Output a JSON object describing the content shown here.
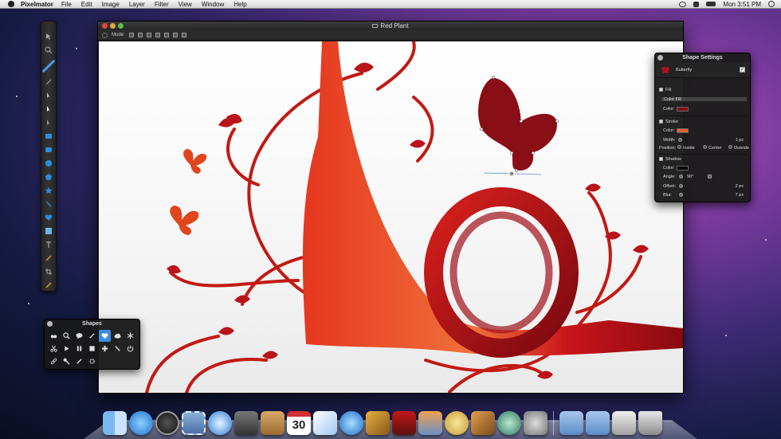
{
  "menubar": {
    "app_name": "Pixelmator",
    "items": [
      "File",
      "Edit",
      "Image",
      "Layer",
      "Filter",
      "View",
      "Window",
      "Help"
    ],
    "clock": "Mon 3:51 PM",
    "icons": [
      "apple-icon",
      "wifi-icon",
      "volume-icon",
      "battery-icon",
      "spotlight-icon"
    ]
  },
  "tools": {
    "icons": [
      "move-icon",
      "zoom-icon",
      "brush-icon",
      "pen-icon",
      "selection-arrow-icon",
      "arrow-icon",
      "pointer-icon",
      "rectangle-icon",
      "rounded-rectangle-icon",
      "ellipse-icon",
      "polygon-icon",
      "star-icon",
      "line-icon",
      "heart-icon",
      "gradient-icon",
      "text-icon",
      "paint-bucket-icon",
      "crop-icon",
      "eyedropper-icon"
    ]
  },
  "document": {
    "title": "Red Plant",
    "mode_label": "Mode:"
  },
  "shapes_palette": {
    "title": "Shapes",
    "selected_index": 4,
    "items": [
      "binoculars-icon",
      "magnifier-icon",
      "speech-bubble-icon",
      "pin-icon",
      "heart-icon",
      "cloud-icon",
      "snowflake-icon",
      "scissors-icon",
      "play-icon",
      "pause-icon",
      "stop-icon",
      "plus-icon",
      "pencil-icon",
      "power-icon",
      "link-icon",
      "brush-icon",
      "check-icon",
      "gear-icon"
    ]
  },
  "shape_settings": {
    "title": "Shape Settings",
    "shape_name": "Butterfly",
    "fill": {
      "label": "Fill",
      "type": "Color Fill",
      "color_label": "Color:",
      "color": "#8a0e16"
    },
    "stroke": {
      "label": "Stroke",
      "color_label": "Color:",
      "color": "#e2622e",
      "width_label": "Width:",
      "width_value": "1 px",
      "position_label": "Position:",
      "positions": [
        "Inside",
        "Center",
        "Outside"
      ]
    },
    "shadow": {
      "label": "Shadow",
      "color_label": "Color:",
      "color": "#000000",
      "angle_label": "Angle:",
      "angle_value": "90°",
      "offset_label": "Offset:",
      "offset_value": "2 px",
      "blur_label": "Blur:",
      "blur_value": "7 px"
    }
  },
  "dock": {
    "calendar_day": "30",
    "items": [
      "finder-icon",
      "app-store-icon",
      "dashboard-icon",
      "mail-stamp-icon",
      "safari-icon",
      "facetime-icon",
      "address-book-icon",
      "ical-icon",
      "preview-icon",
      "itunes-icon",
      "pixelmator-icon",
      "photo-booth-icon",
      "iphoto-icon",
      "imovie-icon",
      "garageband-icon",
      "time-machine-icon",
      "system-preferences-icon",
      "applications-folder-icon",
      "documents-folder-icon",
      "downloads-stack-icon",
      "trash-icon"
    ]
  },
  "colors": {
    "accent_blue": "#3a8fe0",
    "artwork_red": "#c8141a"
  }
}
